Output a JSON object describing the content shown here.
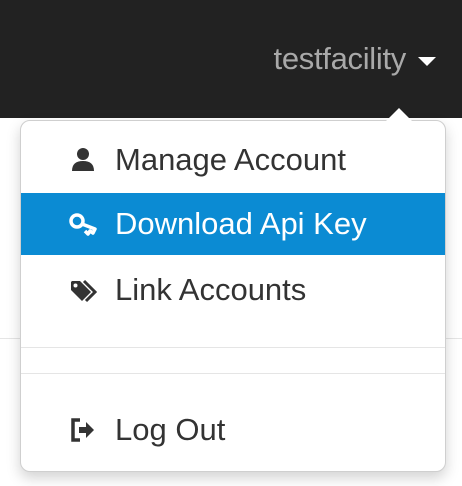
{
  "navbar": {
    "username": "testfacility",
    "username_color": "#a9a9a9",
    "background": "#222222"
  },
  "dropdown": {
    "items": [
      {
        "label": "Manage Account",
        "icon": "user-icon"
      },
      {
        "label": "Download Api Key",
        "icon": "key-icon",
        "active": true
      },
      {
        "label": "Link Accounts",
        "icon": "tags-icon"
      }
    ],
    "logout": {
      "label": "Log Out",
      "icon": "logout-icon"
    },
    "active_color": "#0b8bd3"
  }
}
